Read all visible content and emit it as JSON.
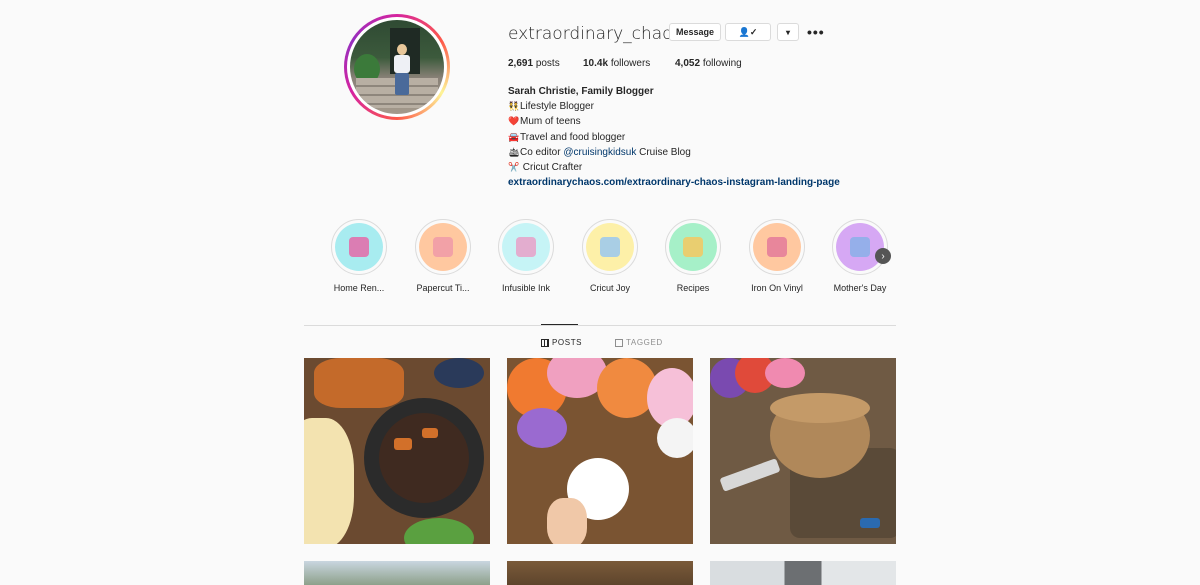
{
  "profile": {
    "username": "extraordinary_chaos",
    "message_label": "Message",
    "follow_icon": "person-check-icon",
    "dropdown_icon": "caret-down-icon",
    "more_label": "•••",
    "stats": {
      "posts_count": "2,691",
      "posts_label": "posts",
      "followers_count": "10.4k",
      "followers_label": "followers",
      "following_count": "4,052",
      "following_label": "following"
    },
    "bio": {
      "name": "Sarah Christie, Family Blogger",
      "lines": [
        {
          "emoji": "👯",
          "text": "Lifestyle Blogger"
        },
        {
          "emoji": "❤️",
          "text": "Mum of teens"
        },
        {
          "emoji": "🚘",
          "text": "Travel and food blogger"
        },
        {
          "emoji": "🛳",
          "text_before": "Co editor ",
          "mention": "@cruisingkidsuk",
          "text_after": " Cruise Blog"
        },
        {
          "emoji": "✂️",
          "text": " Cricut Crafter"
        }
      ],
      "link": "extraordinarychaos.com/extraordinary-chaos-instagram-landing-page"
    }
  },
  "highlights": [
    {
      "label": "Home Ren...",
      "color": "#a8ecf0",
      "glyph_color": "#e46aa8"
    },
    {
      "label": "Papercut Ti...",
      "color": "#ffc8a0",
      "glyph_color": "#f09aa8"
    },
    {
      "label": "Infusible Ink",
      "color": "#c6f4f6",
      "glyph_color": "#e8a0c8"
    },
    {
      "label": "Cricut Joy",
      "color": "#fdf0a8",
      "glyph_color": "#9ac8f0"
    },
    {
      "label": "Recipes",
      "color": "#a6f0c8",
      "glyph_color": "#f4c860"
    },
    {
      "label": "Iron On Vinyl",
      "color": "#ffc8a0",
      "glyph_color": "#e47a9a"
    },
    {
      "label": "Mother's Day",
      "color": "#d6a8f4",
      "glyph_color": "#8ab0e8"
    }
  ],
  "highlights_next_icon": "chevron-right-icon",
  "tabs": {
    "posts": "POSTS",
    "tagged": "TAGGED"
  }
}
